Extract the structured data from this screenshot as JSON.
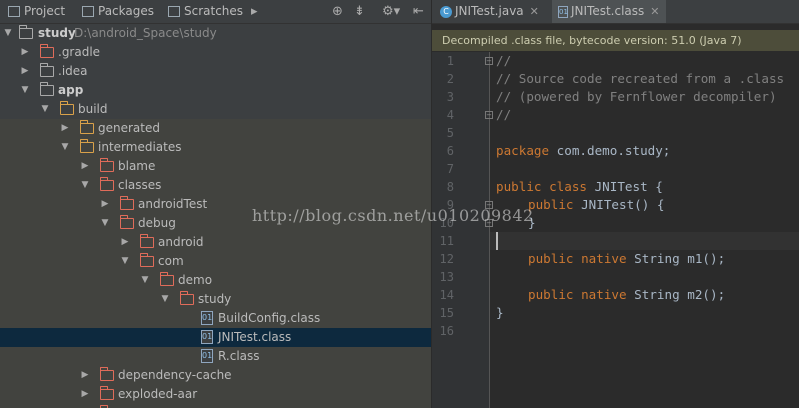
{
  "project_tabs": [
    {
      "label": "Project",
      "icon": "project-icon"
    },
    {
      "label": "Packages",
      "icon": "packages-icon"
    },
    {
      "label": "Scratches",
      "icon": "scratches-icon"
    }
  ],
  "tree": {
    "root": {
      "label": "study",
      "path": "D:\\android_Space\\study"
    },
    "items": [
      {
        "label": ".gradle"
      },
      {
        "label": ".idea"
      },
      {
        "label": "app"
      },
      {
        "label": "build"
      },
      {
        "label": "generated"
      },
      {
        "label": "intermediates"
      },
      {
        "label": "blame"
      },
      {
        "label": "classes"
      },
      {
        "label": "androidTest"
      },
      {
        "label": "debug"
      },
      {
        "label": "android"
      },
      {
        "label": "com"
      },
      {
        "label": "demo"
      },
      {
        "label": "study"
      },
      {
        "label": "BuildConfig.class"
      },
      {
        "label": "JNITest.class"
      },
      {
        "label": "R.class"
      },
      {
        "label": "dependency-cache"
      },
      {
        "label": "exploded-aar"
      }
    ]
  },
  "editor_tabs": [
    {
      "label": "JNITest.java"
    },
    {
      "label": "JNITest.class"
    }
  ],
  "banner": "Decompiled .class file, bytecode version: 51.0 (Java 7)",
  "code": {
    "line_numbers": [
      "1",
      "2",
      "3",
      "4",
      "5",
      "6",
      "7",
      "8",
      "9",
      "10",
      "11",
      "12",
      "13",
      "14",
      "15",
      "16"
    ],
    "l1": "//",
    "l2": "// Source code recreated from a .class",
    "l3": "// (powered by Fernflower decompiler)",
    "l4": "//",
    "l6_kw": "package",
    "l6_rest": " com.demo.study;",
    "l8_kw": "public class",
    "l8_rest": " JNITest {",
    "l9_kw": "public",
    "l9_name": " JNITest",
    "l9_rest": "() {",
    "l10": "}",
    "l12_kw": "public native",
    "l12_type": " String",
    "l12_name": " m1",
    "l12_rest": "();",
    "l14_kw": "public native",
    "l14_type": " String",
    "l14_name": " m2",
    "l14_rest": "();",
    "l15": "}"
  },
  "watermark": "http://blog.csdn.net/u010209842"
}
